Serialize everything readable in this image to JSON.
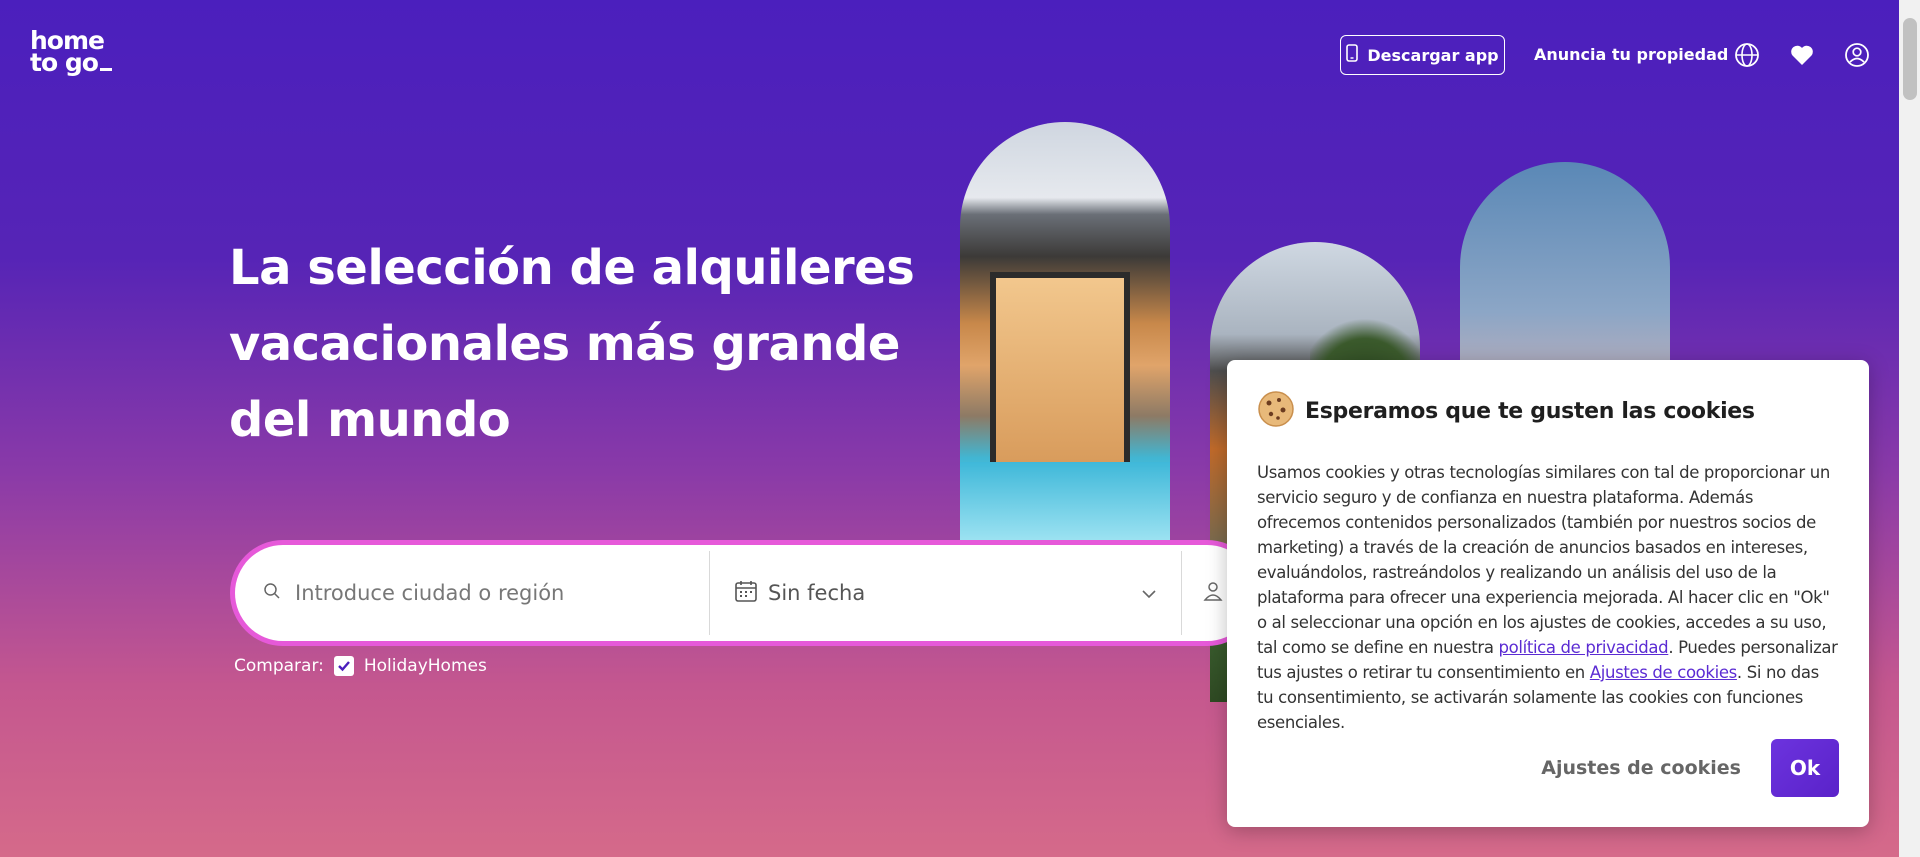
{
  "header": {
    "logo_line1": "home",
    "logo_line2": "to go",
    "download_app_label": "Descargar app",
    "list_property_label": "Anuncia tu propiedad",
    "icons": [
      "phone-icon",
      "globe-icon",
      "heart-icon",
      "user-icon"
    ]
  },
  "hero": {
    "title": "La selección de alquileres vacacionales más grande del mundo"
  },
  "search": {
    "city_placeholder": "Introduce ciudad o región",
    "date_label": "Sin fecha",
    "icons": [
      "search-icon",
      "calendar-icon",
      "chevron-down-icon",
      "guests-icon"
    ]
  },
  "compare": {
    "label": "Comparar:",
    "option_label": "HolidayHomes",
    "option_checked": true
  },
  "cookie_dialog": {
    "title": "Esperamos que te gusten las cookies",
    "body_part1": "Usamos cookies y otras tecnologías similares con tal de proporcionar un servicio seguro y de confianza en nuestra plataforma. Además ofrecemos contenidos personalizados (también por nuestros socios de marketing) a través de la creación de anuncios basados en intereses, evaluándolos, rastreándolos y realizando un análisis del uso de la plataforma para ofrecer una experiencia mejorada. Al hacer clic en \"Ok\" o al seleccionar una opción en los ajustes de cookies, accedes a su uso, tal como se define en nuestra ",
    "privacy_link": "política de privacidad",
    "body_part2": ". Puedes personalizar tus ajustes o retirar tu consentimiento en ",
    "settings_link": "Ajustes de cookies",
    "body_part3": ". Si no das tu consentimiento, se activarán solamente las cookies con funciones esenciales.",
    "settings_button": "Ajustes de cookies",
    "ok_button": "Ok"
  },
  "colors": {
    "brand_purple": "#4b1fbd",
    "search_border": "#e659d9",
    "ok_button": "#5a22c9",
    "link": "#5b2bd3"
  }
}
